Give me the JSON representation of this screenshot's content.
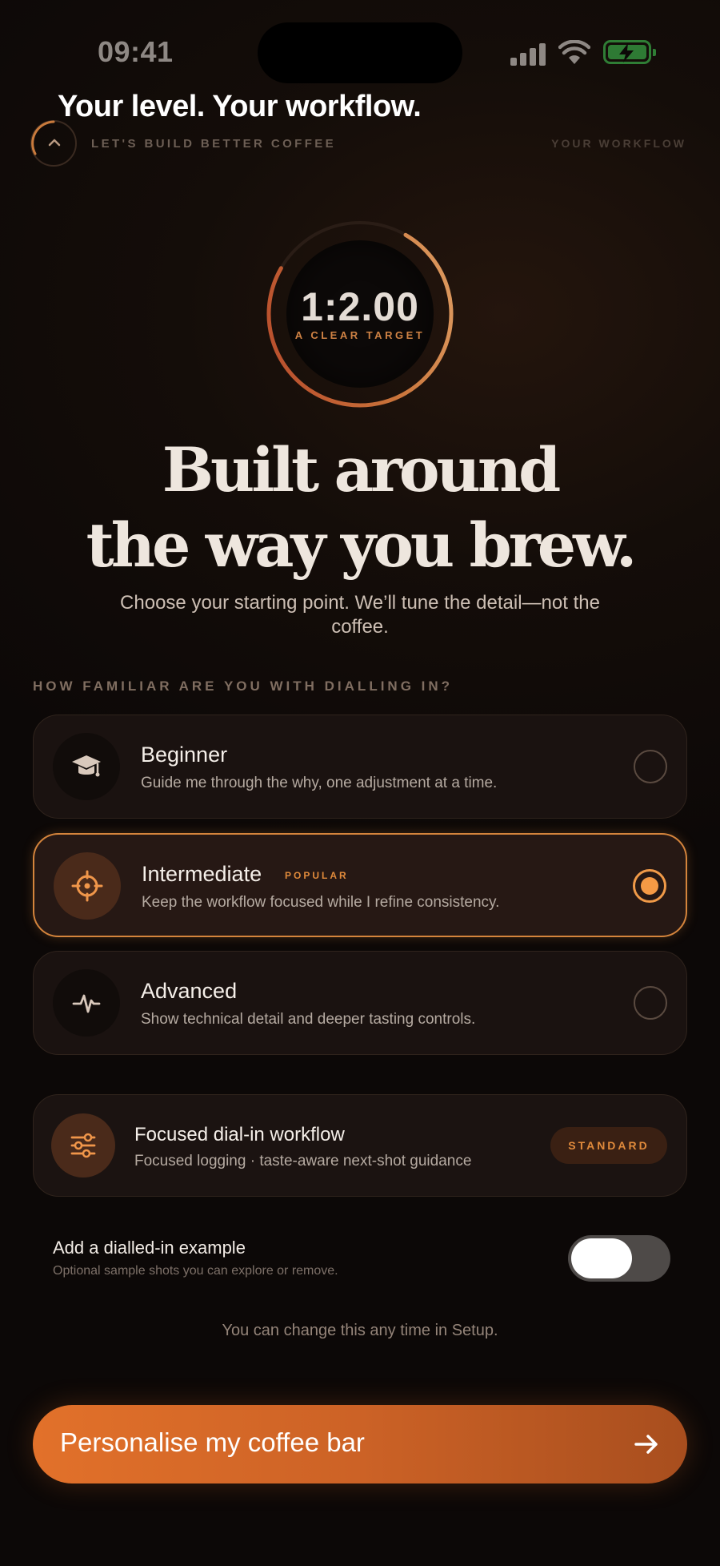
{
  "status_bar": {
    "time": "09:41"
  },
  "header": {
    "title": "Your level. Your workflow.",
    "kicker": "LET'S BUILD BETTER COFFEE",
    "step_label": "YOUR WORKFLOW",
    "back_icon": "chevron-up-icon"
  },
  "ratio_ring": {
    "value": "1:2.00",
    "caption": "A CLEAR TARGET",
    "progress": 0.75
  },
  "hero": {
    "line1": "Built around",
    "line2": "the way you brew.",
    "subtitle": "Choose your starting point. We’ll tune the detail—not the coffee."
  },
  "levels": {
    "question": "HOW FAMILIAR ARE YOU WITH DIALLING IN?",
    "options": [
      {
        "title": "Beginner",
        "description": "Guide me through the why, one adjustment at a time.",
        "icon": "graduation-cap-icon",
        "selected": false
      },
      {
        "title": "Intermediate",
        "badge": "POPULAR",
        "description": "Keep the workflow focused while I refine consistency.",
        "icon": "crosshair-icon",
        "selected": true
      },
      {
        "title": "Advanced",
        "description": "Show technical detail and deeper tasting controls.",
        "icon": "pulse-icon",
        "selected": false
      }
    ]
  },
  "workflow": {
    "title": "Focused dial-in workflow",
    "description": "Focused logging · taste-aware next-shot guidance",
    "badge": "STANDARD",
    "icon": "sliders-icon"
  },
  "example_toggle": {
    "title": "Add a dialled-in example",
    "description": "Optional sample shots you can explore or remove.",
    "enabled": false
  },
  "footnote": "You can change this any time in Setup.",
  "cta": {
    "label": "Personalise my coffee bar",
    "icon": "arrow-right-icon"
  },
  "colors": {
    "accent": "#e2712a",
    "selected_border": "#d4843c",
    "background": "#140d09"
  }
}
